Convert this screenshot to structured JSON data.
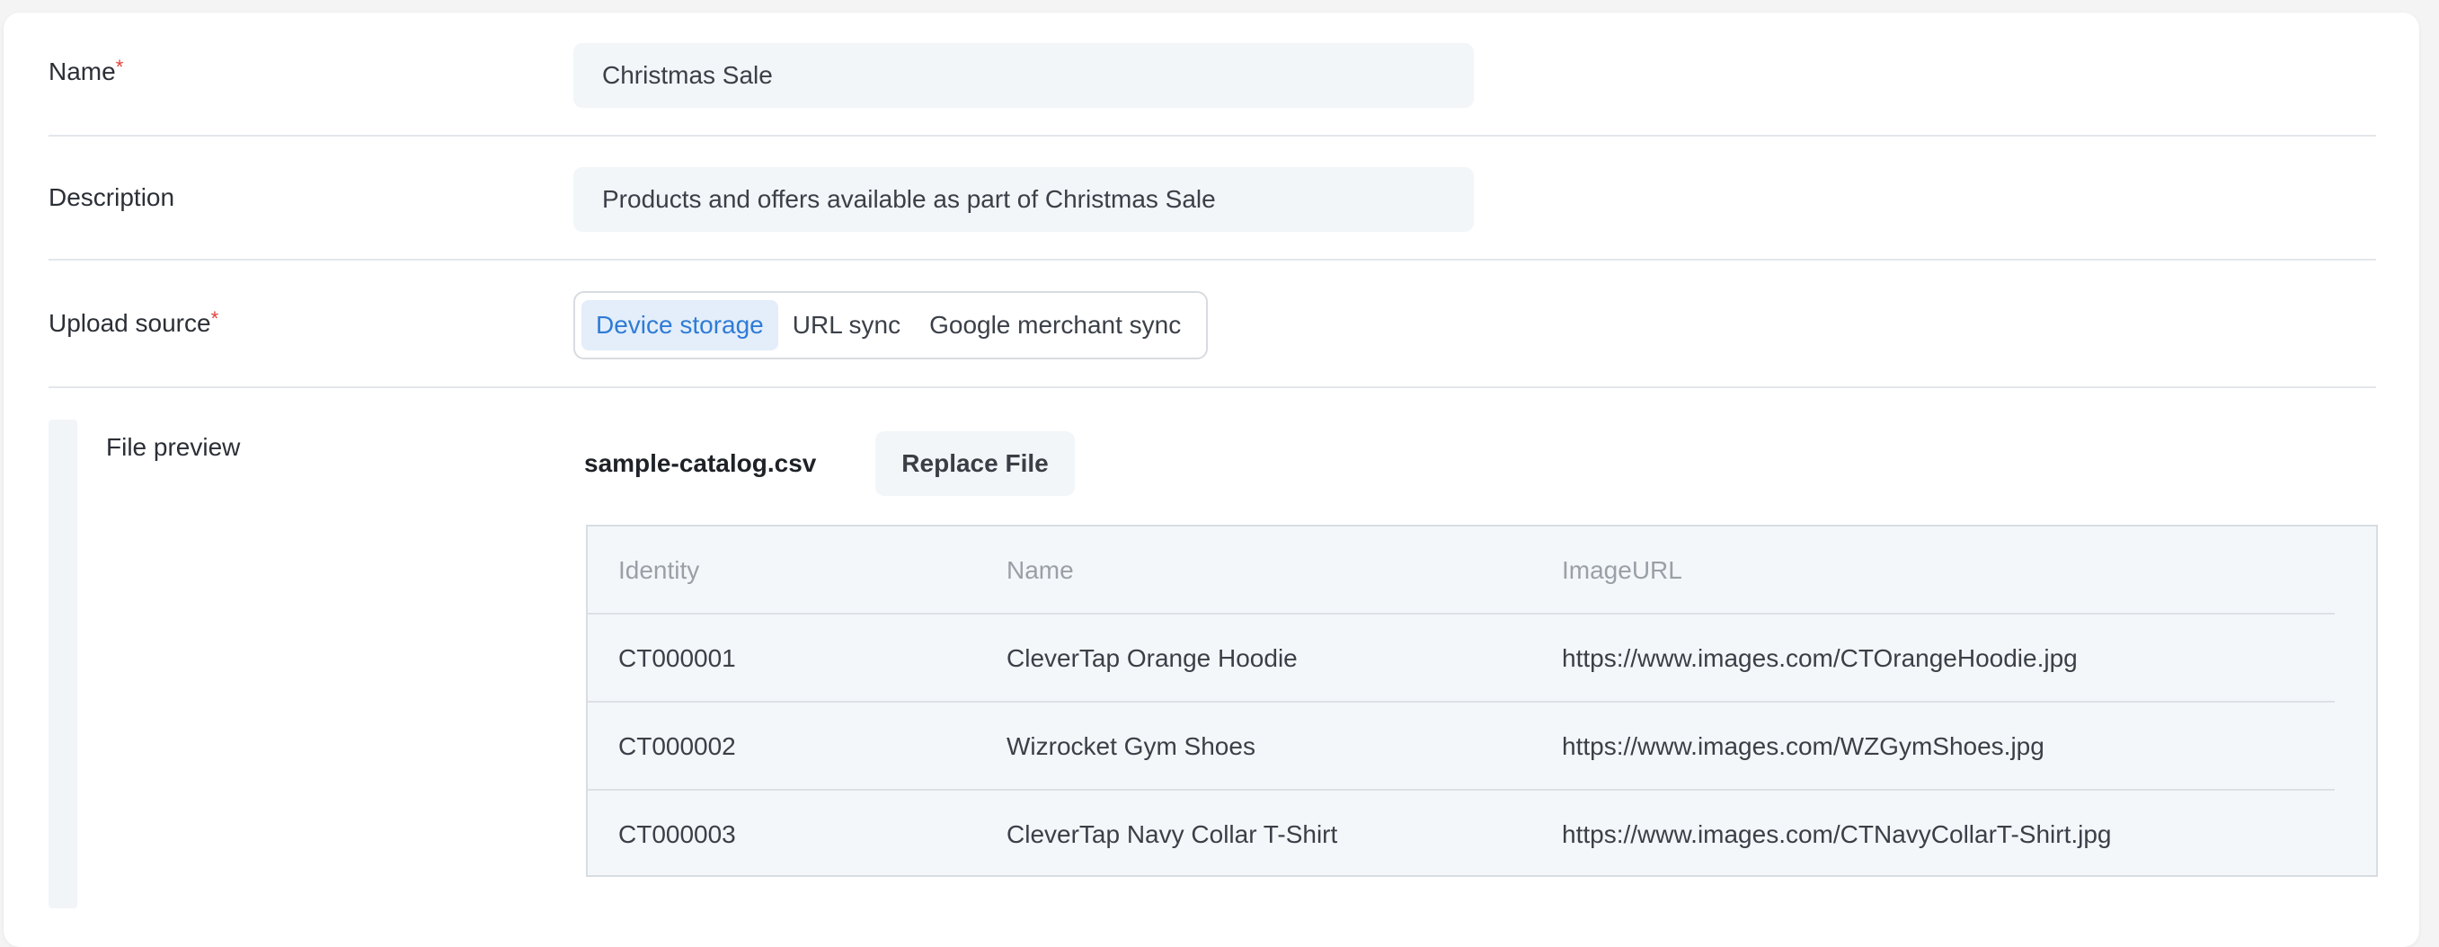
{
  "form": {
    "name": {
      "label": "Name",
      "required_mark": "*",
      "value": "Christmas Sale"
    },
    "description": {
      "label": "Description",
      "value": "Products and offers available as part of Christmas Sale"
    },
    "upload_source": {
      "label": "Upload source",
      "required_mark": "*",
      "options": [
        "Device storage",
        "URL sync",
        "Google merchant sync"
      ],
      "selected": "Device storage"
    },
    "file_preview": {
      "label": "File preview",
      "file_name": "sample-catalog.csv",
      "replace_label": "Replace File",
      "table": {
        "headers": [
          "Identity",
          "Name",
          "ImageURL"
        ],
        "rows": [
          [
            "CT000001",
            "CleverTap Orange Hoodie",
            "https://www.images.com/CTOrangeHoodie.jpg"
          ],
          [
            "CT000002",
            "Wizrocket Gym Shoes",
            "https://www.images.com/WZGymShoes.jpg"
          ],
          [
            "CT000003",
            "CleverTap Navy Collar T-Shirt",
            "https://www.images.com/CTNavyCollarT-Shirt.jpg"
          ]
        ]
      }
    }
  },
  "colors": {
    "accent": "#2f7bd6",
    "required": "#e0413c",
    "input_bg": "#f2f6f9"
  }
}
